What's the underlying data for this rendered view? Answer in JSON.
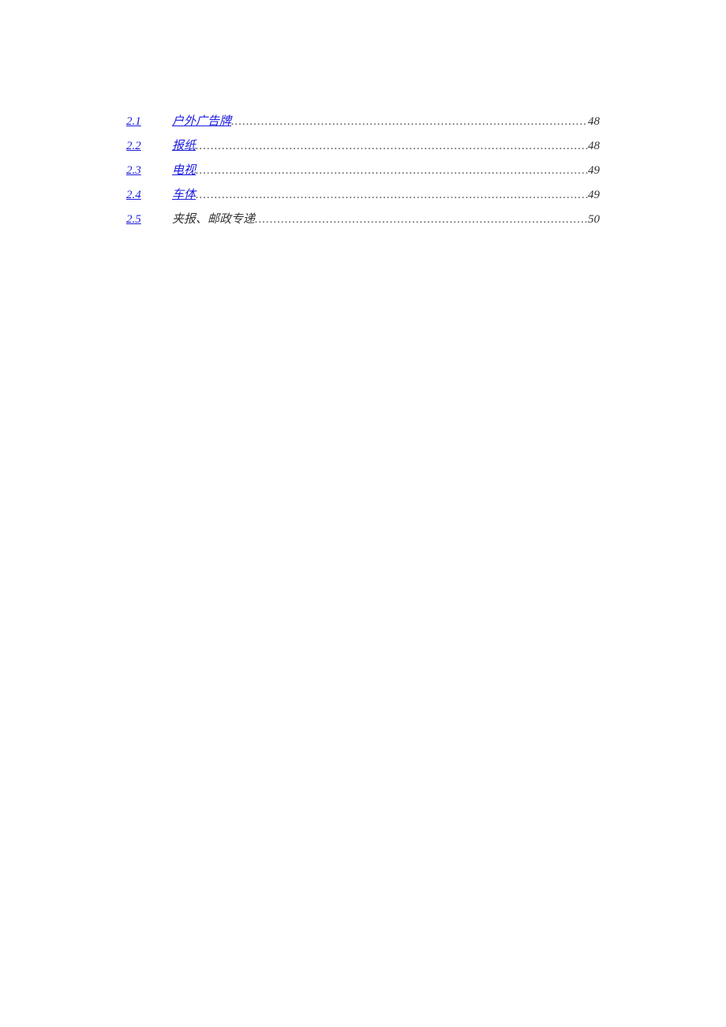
{
  "toc": [
    {
      "number": "2.1",
      "title": "户外广告牌",
      "page": "48",
      "linked": true
    },
    {
      "number": "2.2",
      "title": "报纸",
      "page": "48",
      "linked": true
    },
    {
      "number": "2.3",
      "title": "电视",
      "page": "49",
      "linked": true
    },
    {
      "number": "2.4",
      "title": "车体",
      "page": "49",
      "linked": true
    },
    {
      "number": "2.5",
      "title": "夹报、邮政专递",
      "page": "50",
      "linked": false
    }
  ]
}
